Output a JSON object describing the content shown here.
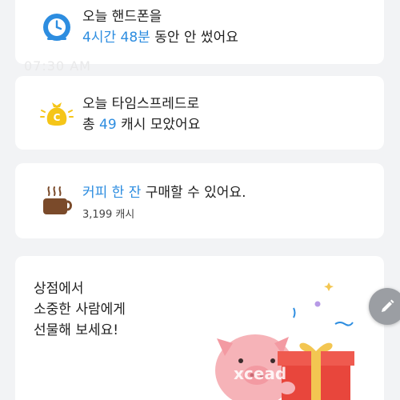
{
  "cards": {
    "phone": {
      "icon": "clock-phone-icon",
      "line1": "오늘 핸드폰을",
      "time_hours": "4시간",
      "time_minutes": "48분",
      "line2_tail": "동안 안 썼어요"
    },
    "ghost_time": "07:30 AM",
    "cash": {
      "icon": "coin-bag-icon",
      "line1": "오늘 타임스프레드로",
      "prefix": "총",
      "amount": "49",
      "suffix": "캐시 모았어요"
    },
    "coffee": {
      "icon": "coffee-cup-icon",
      "accent": "커피 한 잔",
      "tail": "구매할 수 있어요.",
      "price": "3,199 캐시"
    },
    "shop": {
      "line1": "상점에서",
      "line2": "소중한 사람에게",
      "line3": "선물해 보세요!",
      "illustration": "pig-with-gift-illustration"
    }
  },
  "fab_icon": "pencil-icon",
  "watermark": "xcead",
  "colors": {
    "accent": "#2d8de0",
    "background": "#f2f3f5",
    "card": "#ffffff",
    "coin": "#f5c518",
    "coffee": "#7a4a2a",
    "pig": "#f6b3b8",
    "gift": "#e8463c",
    "ribbon": "#f3c651",
    "fab": "#9b9ea3"
  }
}
